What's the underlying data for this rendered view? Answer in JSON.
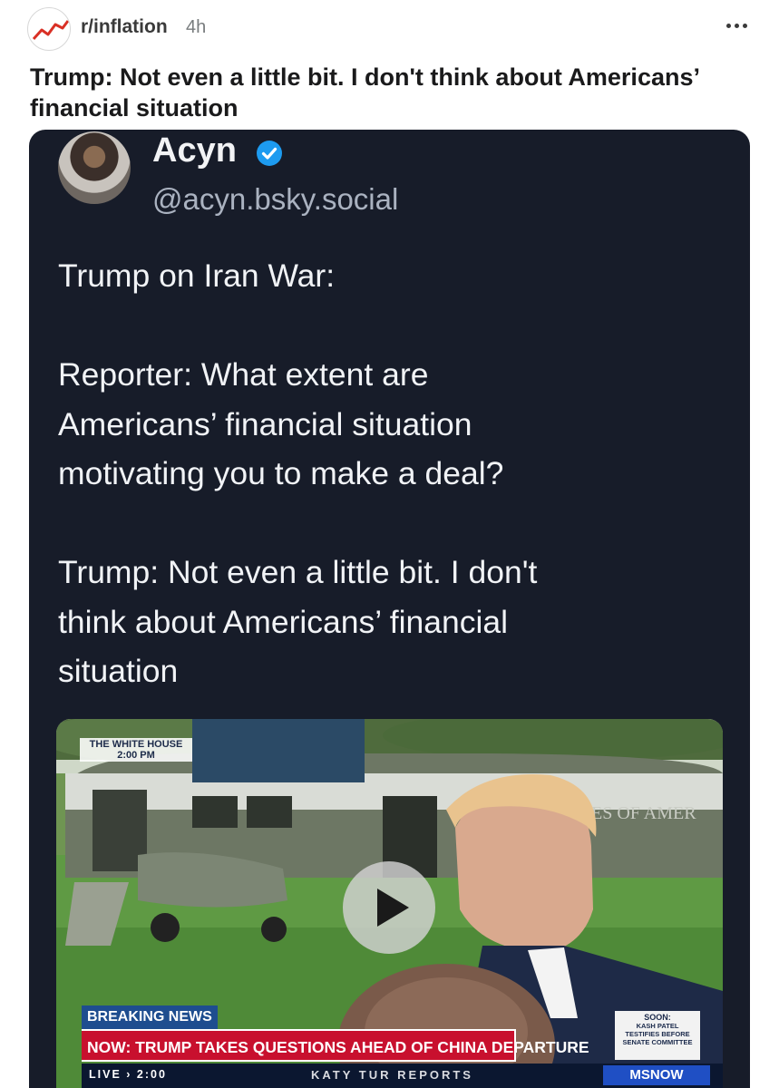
{
  "header": {
    "subreddit": "r/inflation",
    "age": "4h"
  },
  "post": {
    "title": "Trump: Not even a little bit. I don't think about Americans’ financial situation"
  },
  "embed": {
    "display_name": "Acyn",
    "handle": "@acyn.bsky.social",
    "lines": [
      "Trump on Iran War:",
      "",
      "Reporter: What extent are",
      "Americans’ financial situation",
      "motivating you to make a deal?",
      "",
      "Trump: Not even a little bit. I don't",
      "think about Americans’ financial",
      "situation"
    ]
  },
  "video": {
    "location_line1": "THE WHITE HOUSE",
    "location_line2": "2:00 PM",
    "breaking_label": "BREAKING NEWS",
    "headline": "NOW: TRUMP TAKES QUESTIONS AHEAD OF CHINA DEPARTURE",
    "live_label": "LIVE › 2:00",
    "show_name": "KATY TUR REPORTS",
    "network": "MSNOW",
    "soon_label": "SOON:",
    "soon_lines": [
      "KASH PATEL",
      "TESTIFIES BEFORE",
      "SENATE COMMITTEE"
    ],
    "helicopter_text": "ES OF AMER"
  },
  "colors": {
    "card_bg": "#171c29",
    "verified": "#1d9bf0",
    "breaking_bg": "#1e4d8f",
    "headline_bg": "#c8102e"
  }
}
